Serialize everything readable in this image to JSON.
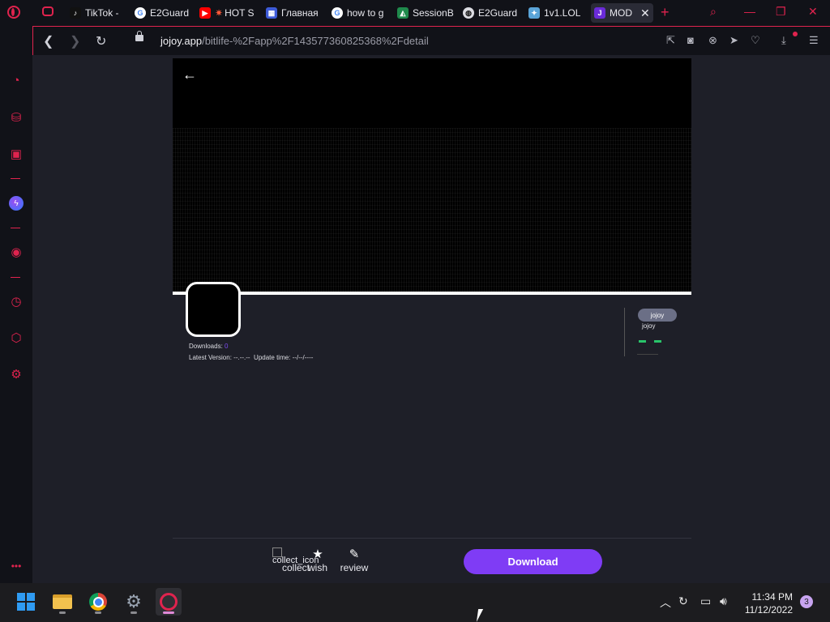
{
  "tabs": [
    {
      "title": "TikTok -",
      "favicon": "tiktok-icon"
    },
    {
      "title": "E2Guard",
      "favicon": "google-icon"
    },
    {
      "title": "HOT S",
      "favicon": "youtube-icon"
    },
    {
      "title": "Главная",
      "favicon": "grid-icon"
    },
    {
      "title": "how to g",
      "favicon": "google-icon"
    },
    {
      "title": "SessionB",
      "favicon": "session-icon"
    },
    {
      "title": "E2Guard",
      "favicon": "globe-icon"
    },
    {
      "title": "1v1.LOL",
      "favicon": "game-icon"
    },
    {
      "title": "MOD",
      "favicon": "jojoy-icon",
      "active": true
    }
  ],
  "address": {
    "domain": "jojoy.app",
    "path": "/bitlife-%2Fapp%2F143577360825368%2Fdetail"
  },
  "app": {
    "downloads_label": "Downloads:",
    "downloads_value": "0",
    "latest_version_label": "Latest Version:",
    "latest_version_value": "--.--.--",
    "update_time_label": "Update time:",
    "update_time_value": "--/--/----"
  },
  "side": {
    "pill_alt": "jojoy",
    "label": "jojoy"
  },
  "actions": {
    "collect_icon_alt": "collect_icon",
    "collect": "collect",
    "wish": "wish",
    "review": "review",
    "download": "Download"
  },
  "taskbar": {
    "time": "11:34 PM",
    "date": "11/12/2022",
    "notifications": "3"
  },
  "colors": {
    "accent": "#e0234e",
    "download": "#7f3cf5",
    "version_value": "#7c4cf0"
  }
}
